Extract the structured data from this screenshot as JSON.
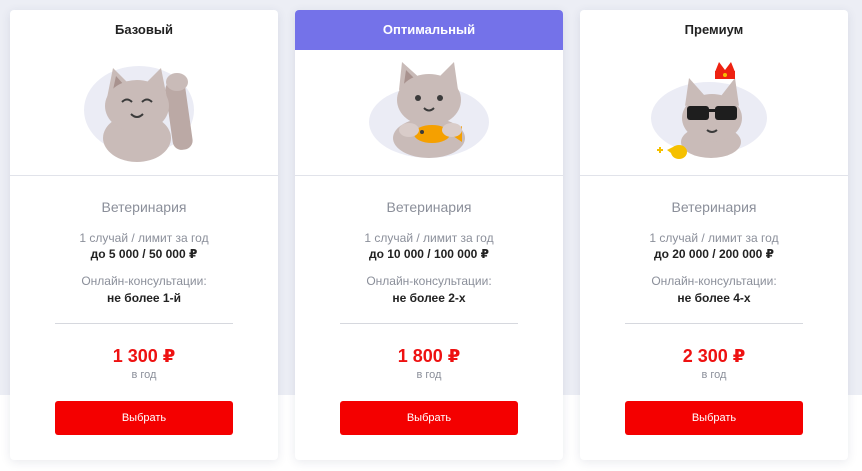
{
  "plans": [
    {
      "name": "Базовый",
      "category": "Ветеринария",
      "limit_label": "1 случай / лимит за год",
      "limit_value": "до 5 000 / 50 000 ₽",
      "consult_label": "Онлайн-консультации:",
      "consult_value": "не более 1-й",
      "price": "1 300 ₽",
      "period": "в год",
      "button": "Выбрать",
      "illustration": "waving-cat-icon"
    },
    {
      "name": "Оптимальный",
      "category": "Ветеринария",
      "limit_label": "1 случай / лимит за год",
      "limit_value": "до 10 000 / 100 000 ₽",
      "consult_label": "Онлайн-консультации:",
      "consult_value": "не более 2-х",
      "price": "1 800 ₽",
      "period": "в год",
      "button": "Выбрать",
      "illustration": "cat-with-fish-icon"
    },
    {
      "name": "Премиум",
      "category": "Ветеринария",
      "limit_label": "1 случай / лимит за год",
      "limit_value": "до 20 000 / 200 000 ₽",
      "consult_label": "Онлайн-консультации:",
      "consult_value": "не более 4-х",
      "price": "2 300 ₽",
      "period": "в год",
      "button": "Выбрать",
      "illustration": "cat-with-crown-and-sunglasses-icon"
    }
  ],
  "colors": {
    "featured_header": "#7472e9",
    "price": "#ee1111",
    "button": "#f40000",
    "background": "#eceef5"
  }
}
